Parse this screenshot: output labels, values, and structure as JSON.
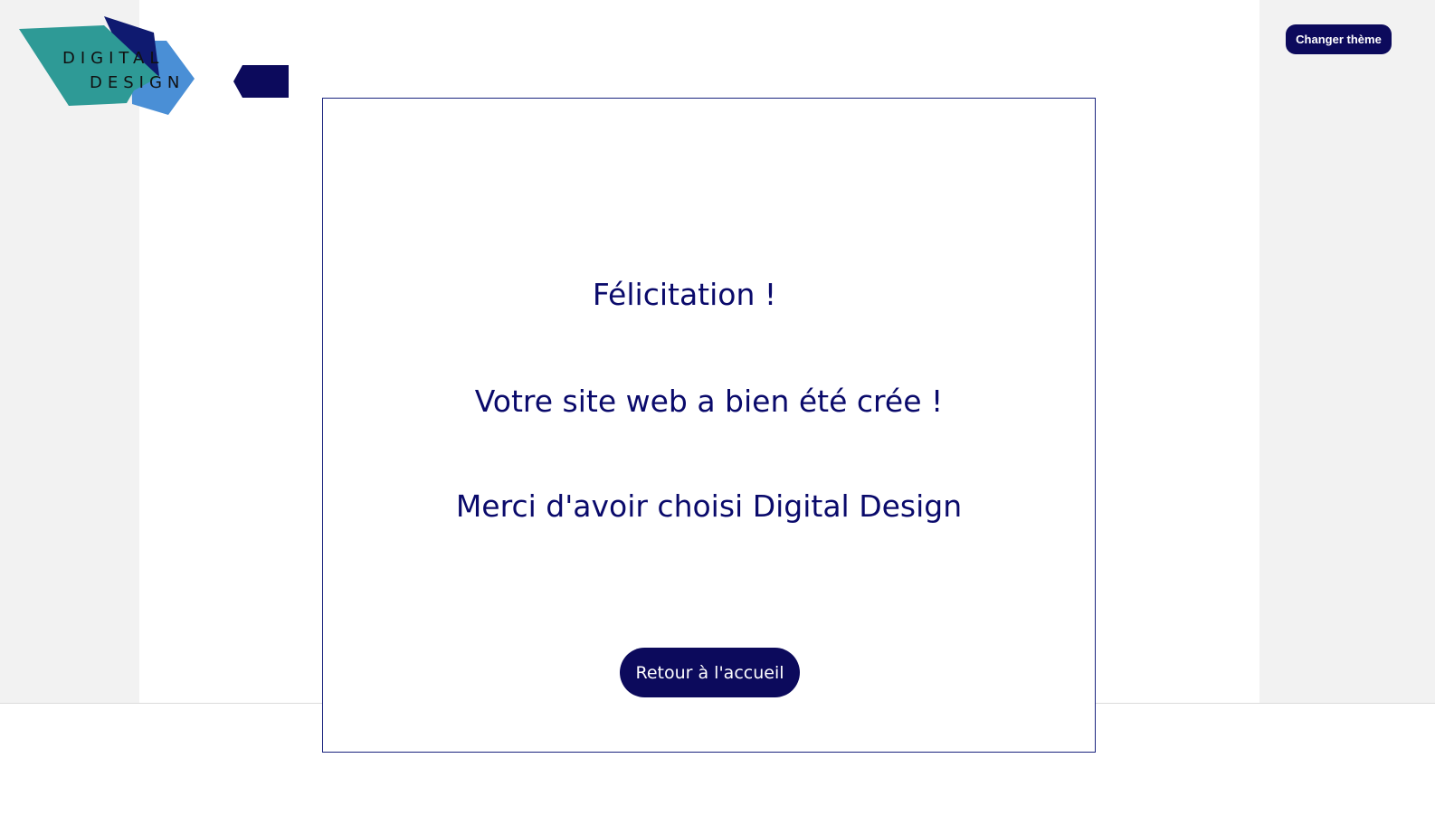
{
  "header": {
    "logo_line1": "DIGITAL",
    "logo_line2": "DESIGN",
    "theme_button_label": "Changer thème"
  },
  "modal": {
    "title": "Félicitation !",
    "message": "Votre site web a bien été crée !",
    "thanks": "Merci d'avoir choisi Digital Design",
    "home_button_label": "Retour à l'accueil"
  },
  "colors": {
    "primary_navy": "#0c0a5c",
    "text_navy": "#0a0a6b",
    "logo_teal": "#2e9a96",
    "logo_blue": "#4a8fd6",
    "logo_dark": "#0f1a70",
    "side_gray": "#f2f2f2"
  },
  "icons": {
    "logo": "digital-design-logo",
    "nav": "nav-arrow-tab-icon"
  }
}
